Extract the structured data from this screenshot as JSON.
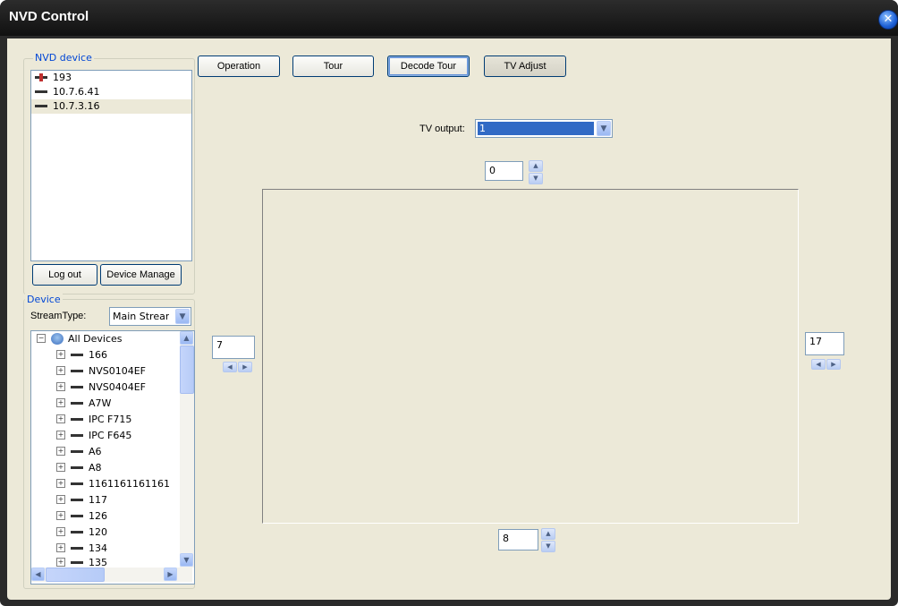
{
  "window": {
    "title": "NVD Control",
    "close_glyph": "✕"
  },
  "nvd_group": {
    "legend": "NVD device",
    "items": [
      {
        "label": "193",
        "icon": "nvd-device-icon-red"
      },
      {
        "label": "10.7.6.41",
        "icon": "nvd-device-icon"
      },
      {
        "label": "10.7.3.16",
        "icon": "nvd-device-icon"
      }
    ],
    "logout_label": "Log out",
    "manage_label": "Device Manage"
  },
  "device_group": {
    "legend": "Device",
    "stream_label": "StreamType:",
    "stream_value": "Main Strear",
    "root_label": "All Devices",
    "items": [
      "166",
      "NVS0104EF",
      "NVS0404EF",
      "A7W",
      "IPC F715",
      "IPC F645",
      "A6",
      "A8",
      "1161161161161",
      "117",
      "126",
      "120",
      "134",
      "135"
    ]
  },
  "toolbar": {
    "operation_label": "Operation",
    "tour_label": "Tour",
    "decode_tour_label": "Decode Tour",
    "tv_adjust_label": "TV Adjust"
  },
  "tv": {
    "output_label": "TV output:",
    "output_value": "1",
    "top_value": "0",
    "left_value": "7",
    "right_value": "17",
    "bottom_value": "8"
  },
  "colors": {
    "accent": "#0046d5",
    "selection": "#316ac5",
    "face": "#ece9d8"
  }
}
